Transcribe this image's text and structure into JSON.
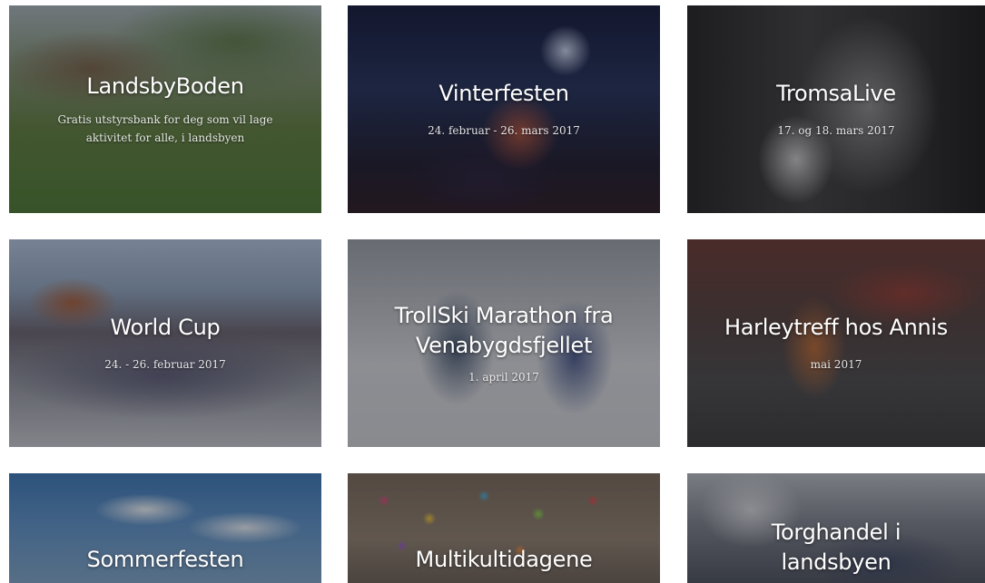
{
  "cards": [
    {
      "title": "LandsbyBoden",
      "subtitle": "Gratis utstyrsbank for deg som vil lage aktivitet for alle, i landsbyen"
    },
    {
      "title": "Vinterfesten",
      "subtitle": "24. februar - 26. mars 2017"
    },
    {
      "title": "TromsaLive",
      "subtitle": "17. og 18. mars 2017"
    },
    {
      "title": "World Cup",
      "subtitle": "24. - 26. februar 2017"
    },
    {
      "title": "TrollSki Marathon fra Venabygdsfjellet",
      "subtitle": "1. april 2017"
    },
    {
      "title": "Harleytreff hos Annis",
      "subtitle": "mai 2017"
    },
    {
      "title": "Sommerfesten",
      "subtitle": ""
    },
    {
      "title": "Multikultidagene",
      "subtitle": ""
    },
    {
      "title": "Torghandel i landsbyen",
      "subtitle": ""
    }
  ]
}
